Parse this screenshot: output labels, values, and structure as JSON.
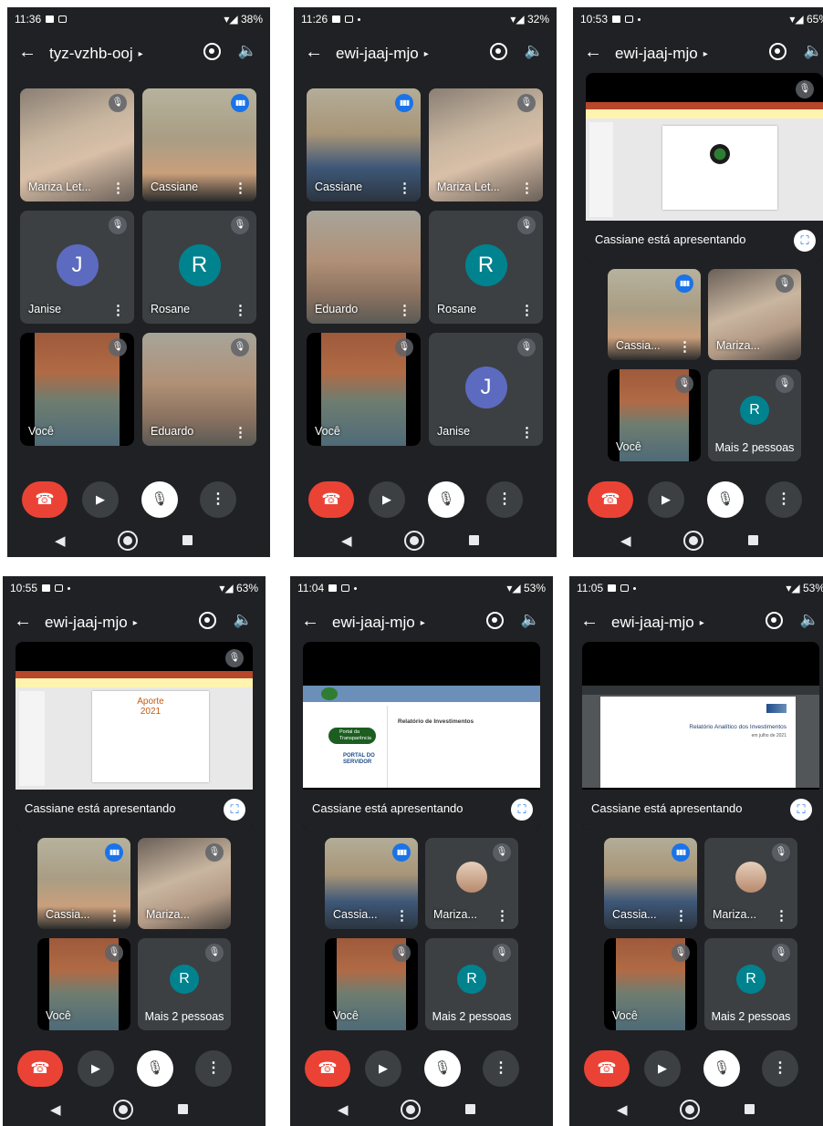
{
  "icons": {
    "back": "←",
    "caret": "▸",
    "volume": "🔈",
    "mic_off": "🎙",
    "speaking": "▮▮▮",
    "kebab": "⋮",
    "hangup": "☎",
    "camera": "▶",
    "nav_back": "◀",
    "fullscreen": "⛶"
  },
  "phones": [
    {
      "status_time": "11:36",
      "battery": "38%",
      "meeting_code": "tyz-vzhb-ooj",
      "tiles": [
        {
          "name": "Mariza Let..."
        },
        {
          "name": "Cassiane"
        },
        {
          "name": "Janise",
          "initial": "J"
        },
        {
          "name": "Rosane",
          "initial": "R"
        },
        {
          "name": "Você"
        },
        {
          "name": "Eduardo"
        }
      ]
    },
    {
      "status_time": "11:26",
      "battery": "32%",
      "meeting_code": "ewi-jaaj-mjo",
      "tiles": [
        {
          "name": "Cassiane"
        },
        {
          "name": "Mariza Let..."
        },
        {
          "name": "Eduardo"
        },
        {
          "name": "Rosane",
          "initial": "R"
        },
        {
          "name": "Você"
        },
        {
          "name": "Janise",
          "initial": "J"
        }
      ]
    },
    {
      "status_time": "10:53",
      "battery": "65%",
      "meeting_code": "ewi-jaaj-mjo",
      "presenting_text": "Cassiane está apresentando",
      "tiles": [
        {
          "name": "Cassia..."
        },
        {
          "name": "Mariza..."
        },
        {
          "name": "Você"
        },
        {
          "more_text": "Mais 2 pessoas",
          "initial": "R"
        }
      ]
    },
    {
      "status_time": "10:55",
      "battery": "63%",
      "meeting_code": "ewi-jaaj-mjo",
      "presenting_text": "Cassiane está apresentando",
      "slide_title": "Aporte\n2021",
      "tiles": [
        {
          "name": "Cassia..."
        },
        {
          "name": "Mariza..."
        },
        {
          "name": "Você"
        },
        {
          "more_text": "Mais 2 pessoas",
          "initial": "R"
        }
      ]
    },
    {
      "status_time": "11:04",
      "battery": "53%",
      "meeting_code": "ewi-jaaj-mjo",
      "presenting_text": "Cassiane está apresentando",
      "slide_heading": "Relatório de Investimentos",
      "slide_badge_1": "Portal da Transparência",
      "slide_badge_2": "PORTAL DO SERVIDOR",
      "tiles": [
        {
          "name": "Cassia..."
        },
        {
          "name": "Mariza..."
        },
        {
          "name": "Você"
        },
        {
          "more_text": "Mais 2 pessoas",
          "initial": "R"
        }
      ]
    },
    {
      "status_time": "11:05",
      "battery": "53%",
      "meeting_code": "ewi-jaaj-mjo",
      "presenting_text": "Cassiane está apresentando",
      "slide_heading": "Relatório Analítico dos Investimentos",
      "slide_sub": "em julho de 2021",
      "tiles": [
        {
          "name": "Cassia..."
        },
        {
          "name": "Mariza..."
        },
        {
          "name": "Você"
        },
        {
          "more_text": "Mais 2 pessoas",
          "initial": "R"
        }
      ]
    }
  ],
  "colors": {
    "background": "#202124",
    "tile": "#3c4043",
    "hangup": "#ea4335",
    "speaking": "#1a73e8",
    "avatar_j": "#5c6bc0",
    "avatar_r": "#00838f"
  }
}
